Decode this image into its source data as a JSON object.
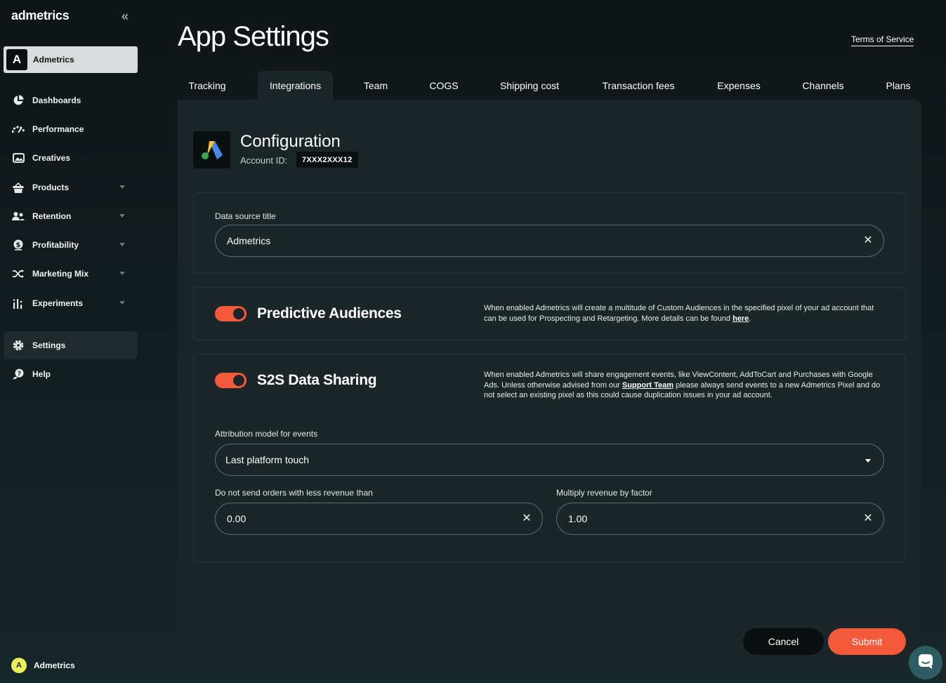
{
  "sidebar": {
    "logo": "admetrics",
    "workspace": {
      "badge": "A",
      "label": "Admetrics"
    },
    "items": [
      {
        "label": "Dashboards",
        "icon": "pie-chart-icon"
      },
      {
        "label": "Performance",
        "icon": "gauge-icon"
      },
      {
        "label": "Creatives",
        "icon": "image-icon"
      },
      {
        "label": "Products",
        "icon": "basket-icon"
      },
      {
        "label": "Retention",
        "icon": "users-icon"
      },
      {
        "label": "Profitability",
        "icon": "dollar-icon"
      },
      {
        "label": "Marketing Mix",
        "icon": "shuffle-icon"
      },
      {
        "label": "Experiments",
        "icon": "bars-icon"
      },
      {
        "label": "Settings",
        "icon": "gear-icon"
      },
      {
        "label": "Help",
        "icon": "help-icon"
      }
    ],
    "user": {
      "initial": "A",
      "name": "Admetrics"
    }
  },
  "header": {
    "title": "App Settings",
    "terms": "Terms of Service"
  },
  "tabs": [
    "Tracking",
    "Integrations",
    "Team",
    "COGS",
    "Shipping cost",
    "Transaction fees",
    "Expenses",
    "Channels",
    "Plans"
  ],
  "active_tab": "Integrations",
  "config": {
    "title": "Configuration",
    "account_label": "Account ID:",
    "account_id": "7XXX2XXX12"
  },
  "data_source": {
    "label": "Data source title",
    "value": "Admetrics"
  },
  "predictive": {
    "title": "Predictive Audiences",
    "desc": "When enabled Admetrics will create a multitude of Custom Audiences in the specified pixel of your ad account that can be used for Prospecting and Retargeting. More details can be found ",
    "link": "here",
    "desc_end": "."
  },
  "s2s": {
    "title": "S2S Data Sharing",
    "desc_a": "When enabled Admetrics will share engagement events, like ViewContent, AddToCart and Purchases with Google Ads. Unless otherwise advised from our ",
    "link": "Support Team",
    "desc_b": " please always send events to a new Admetrics Pixel and do not select an existing pixel as this could cause duplication issues in your ad account.",
    "attribution_label": "Attribution model for events",
    "attribution_value": "Last platform touch",
    "min_revenue_label": "Do not send orders with less revenue than",
    "min_revenue_value": "0.00",
    "factor_label": "Multiply revenue by factor",
    "factor_value": "1.00"
  },
  "actions": {
    "cancel": "Cancel",
    "submit": "Submit"
  },
  "colors": {
    "accent": "#f4593a",
    "panel": "#1b2629"
  }
}
